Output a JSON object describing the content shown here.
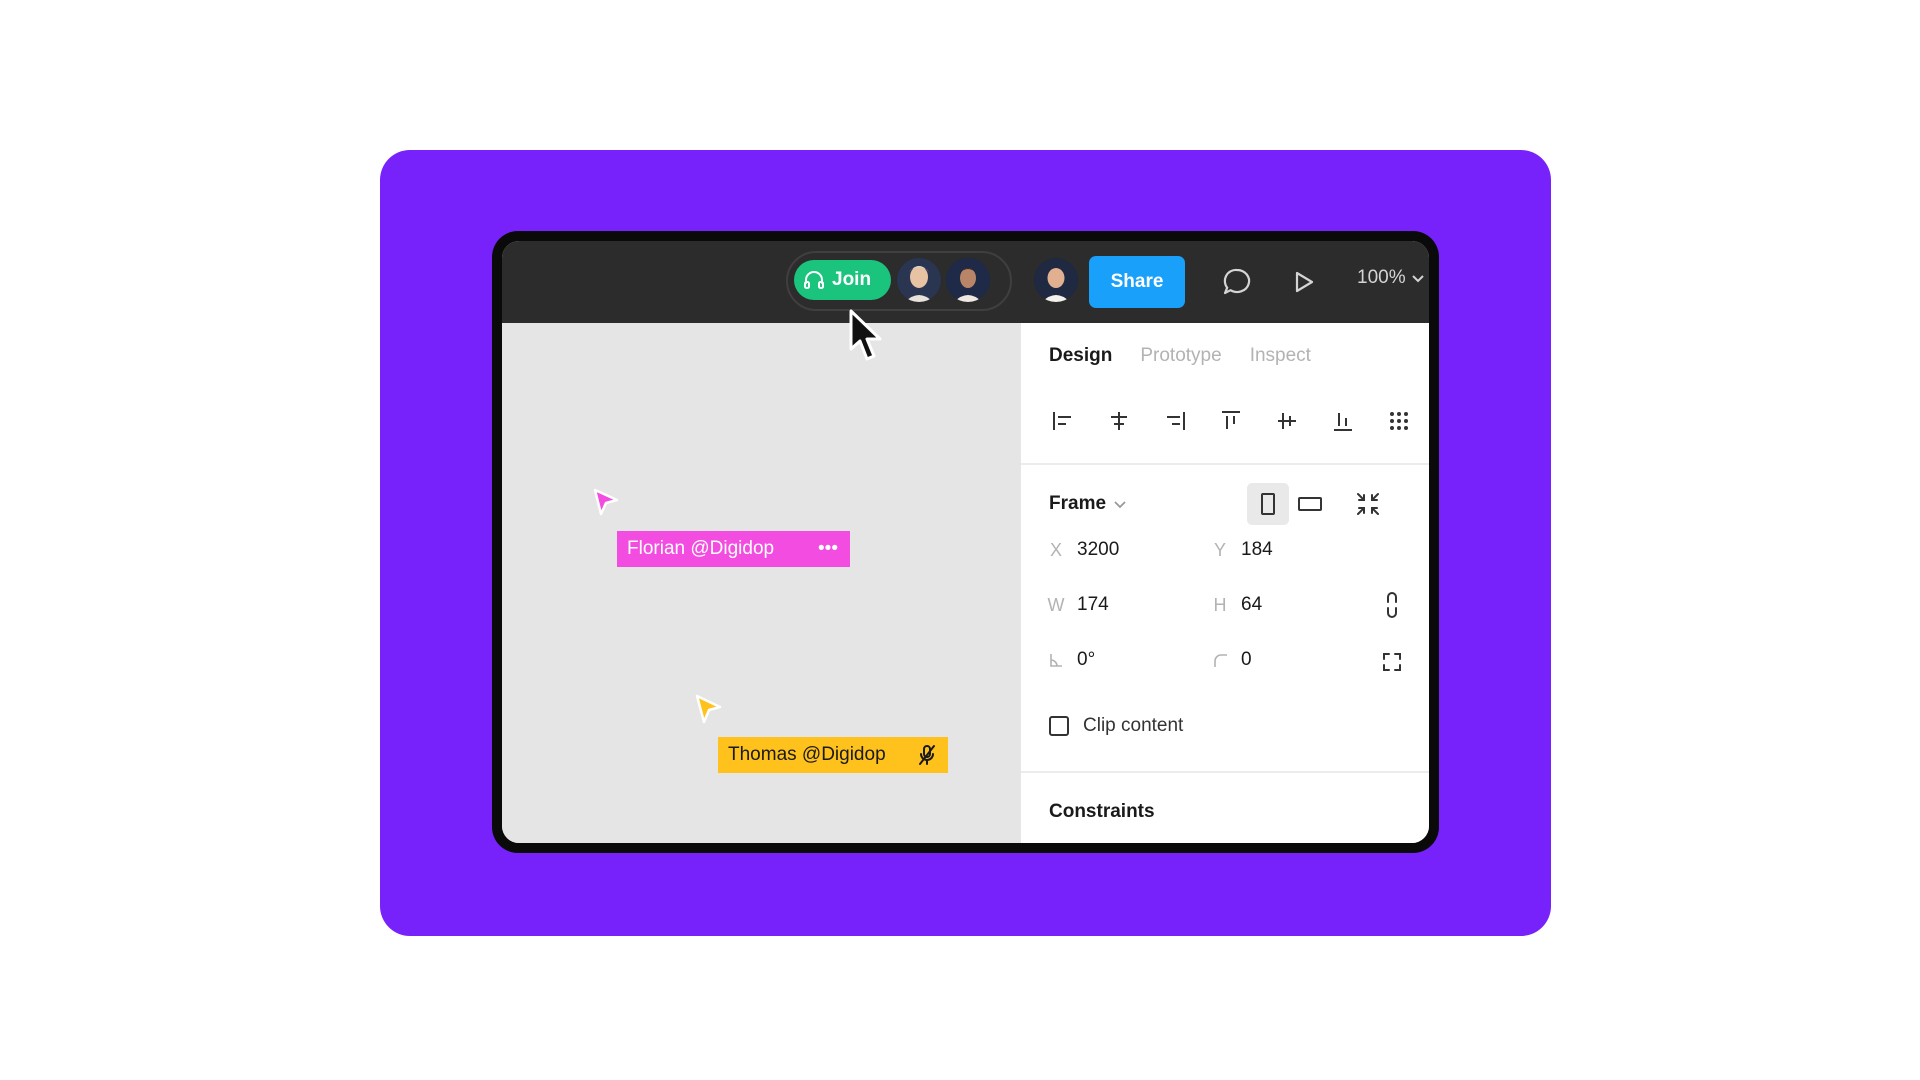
{
  "toolbar": {
    "join_label": "Join",
    "share_label": "Share",
    "zoom_label": "100%",
    "avatars": [
      "avatar-icon",
      "avatar-icon",
      "avatar-icon"
    ],
    "icons": [
      "headphones-icon",
      "comment-icon",
      "play-icon",
      "chevron-down-icon"
    ]
  },
  "canvas": {
    "cursors": [
      {
        "label": "Florian @Digidop",
        "color": "#f24ce1",
        "extra": "•••"
      },
      {
        "label": "Thomas @Digidop",
        "color": "#ffc21c",
        "extra": "muted-mic-icon"
      }
    ]
  },
  "panel": {
    "tabs": [
      "Design",
      "Prototype",
      "Inspect"
    ],
    "active_tab": "Design",
    "frame_title": "Frame",
    "x_label": "X",
    "x_value": "3200",
    "y_label": "Y",
    "y_value": "184",
    "w_label": "W",
    "w_value": "174",
    "h_label": "H",
    "h_value": "64",
    "rotation_value": "0°",
    "radius_value": "0",
    "clip_label": "Clip content",
    "clip_checked": false,
    "constraints_title": "Constraints"
  },
  "colors": {
    "background": "#7822fb",
    "join": "#1bc47d",
    "share": "#18a0fb",
    "topbar": "#2c2c2c"
  }
}
